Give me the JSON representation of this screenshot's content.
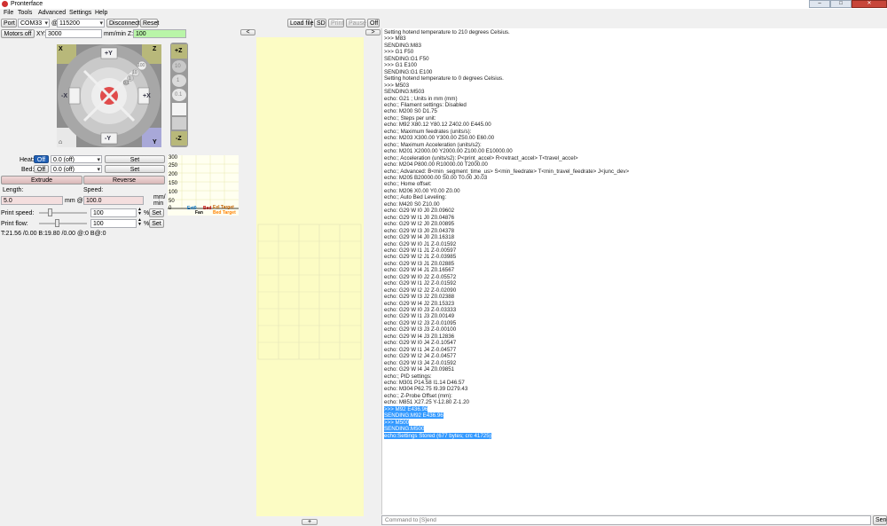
{
  "window": {
    "title": "Pronterface"
  },
  "menu": [
    "File",
    "Tools",
    "Advanced",
    "Settings",
    "Help"
  ],
  "connection": {
    "port_label": "Port",
    "port_value": "COM33",
    "at_label": "@",
    "baud_value": "115200",
    "disconnect_label": "Disconnect",
    "reset_label": "Reset"
  },
  "toolbar": {
    "load_file": "Load file",
    "sd": "SD",
    "print": "Print",
    "pause": "Pause",
    "off": "Off",
    "collapse_left": "<",
    "expand_right": ">",
    "plate_add": "+"
  },
  "motion": {
    "motors_off": "Motors off",
    "xy_label": "XY:",
    "xy_value": "3000",
    "z_label": "mm/min Z:",
    "z_value": "100",
    "jog": {
      "home_x": "X",
      "plus_y": "+Y",
      "z_home": "Z",
      "minus_x": "-X",
      "plus_x": "+X",
      "minus_y": "-Y",
      "home_y": "Y",
      "home_all": "⌂",
      "rings": [
        "100",
        "10",
        "1",
        "0.1"
      ],
      "z_plus": "+Z",
      "z_minus": "-Z",
      "z_steps": [
        "10",
        "1",
        "0.1"
      ]
    }
  },
  "temps": {
    "heat_label": "Heat:",
    "heat_off": "Off",
    "heat_value": "0.0 (off)",
    "bed_label": "Bed:",
    "bed_off": "Off",
    "bed_value": "0.0 (off)",
    "set_label": "Set",
    "extrude": "Extrude",
    "reverse": "Reverse",
    "length_label": "Length:",
    "length_value": "5.0",
    "mm_at": "mm @",
    "speed_label": "Speed:",
    "speed_value": "100.0",
    "speed_unit": "mm/\nmin",
    "print_speed_label": "Print speed:",
    "print_speed_value": "100",
    "print_flow_label": "Print flow:",
    "print_flow_value": "100",
    "percent": "%",
    "status": "T:21.56 /0.00 B:19.80 /0.00 @:0 B@:0"
  },
  "graph": {
    "y_ticks": [
      "300",
      "250",
      "200",
      "150",
      "100",
      "50",
      "0"
    ],
    "legend": [
      {
        "label": "Ext0",
        "color": "#0070c0"
      },
      {
        "label": "Bed",
        "color": "#c00000"
      },
      {
        "label": "Exl Target",
        "color": "#c06000"
      },
      {
        "label": "Fan",
        "color": "#000000"
      },
      {
        "label": "Bed Target",
        "color": "#ff8000"
      }
    ]
  },
  "colors": {
    "accent_blue": "#3399ff",
    "off_button": "#1f5fb5",
    "plate": "#fcfcc4",
    "z_field": "#b9f5a8",
    "jog_olive": "#b8b87a",
    "jog_lavender": "#a8a8d8"
  },
  "console": {
    "lines": [
      {
        "t": "Setting hotend temperature to 210 degrees Celsius."
      },
      {
        "t": ">>> M83"
      },
      {
        "t": "SENDING:M83"
      },
      {
        "t": ">>> G1 F50"
      },
      {
        "t": "SENDING:G1 F50"
      },
      {
        "t": ">>> G1 E100"
      },
      {
        "t": "SENDING:G1 E100"
      },
      {
        "t": "Setting hotend temperature to 0 degrees Celsius."
      },
      {
        "t": ">>> M503"
      },
      {
        "t": "SENDING:M503"
      },
      {
        "t": "echo:  G21    ; Units in mm (mm)"
      },
      {
        "t": "echo:; Filament settings: Disabled"
      },
      {
        "t": "echo:  M200 S0 D1.75"
      },
      {
        "t": "echo:; Steps per unit:"
      },
      {
        "t": "echo: M92 X80.12 Y80.12 Z402.00 E445.00"
      },
      {
        "t": "echo:; Maximum feedrates (units/s):"
      },
      {
        "t": "echo:  M203 X300.00 Y300.00 Z50.00 E60.00"
      },
      {
        "t": "echo:; Maximum Acceleration (units/s2):"
      },
      {
        "t": "echo:  M201 X2000.00 Y2000.00 Z100.00 E10000.00"
      },
      {
        "t": "echo:; Acceleration (units/s2): P<print_accel> R<retract_accel> T<travel_accel>"
      },
      {
        "t": "echo:  M204 P800.00 R10000.00 T2000.00"
      },
      {
        "t": "echo:; Advanced: B<min_segment_time_us> S<min_feedrate> T<min_travel_feedrate> J<junc_dev>"
      },
      {
        "t": "echo:  M205 B20000.00 S0.00 T0.00 J0.03"
      },
      {
        "t": "echo:; Home offset:"
      },
      {
        "t": "echo:  M206 X0.00 Y0.00 Z0.00"
      },
      {
        "t": "echo:; Auto Bed Leveling:"
      },
      {
        "t": "echo:  M420 S0 Z10.00"
      },
      {
        "t": "echo:  G29 W I0 J0 Z0.09602"
      },
      {
        "t": "echo:  G29 W I1 J0 Z0.04876"
      },
      {
        "t": "echo:  G29 W I2 J0 Z0.00895"
      },
      {
        "t": "echo:  G29 W I3 J0 Z0.04378"
      },
      {
        "t": "echo:  G29 W I4 J0 Z0.16318"
      },
      {
        "t": "echo:  G29 W I0 J1 Z-0.01592"
      },
      {
        "t": "echo:  G29 W I1 J1 Z-0.00597"
      },
      {
        "t": "echo:  G29 W I2 J1 Z-0.03985"
      },
      {
        "t": "echo:  G29 W I3 J1 Z0.02885"
      },
      {
        "t": "echo:  G29 W I4 J1 Z0.16567"
      },
      {
        "t": "echo:  G29 W I0 J2 Z-0.05572"
      },
      {
        "t": "echo:  G29 W I1 J2 Z-0.01592"
      },
      {
        "t": "echo:  G29 W I2 J2 Z-0.02090"
      },
      {
        "t": "echo:  G29 W I3 J2 Z0.02388"
      },
      {
        "t": "echo:  G29 W I4 J2 Z0.15323"
      },
      {
        "t": "echo:  G29 W I0 J3 Z-0.03333"
      },
      {
        "t": "echo:  G29 W I1 J3 Z0.00149"
      },
      {
        "t": "echo:  G29 W I2 J3 Z-0.01095"
      },
      {
        "t": "echo:  G29 W I3 J3 Z-0.00100"
      },
      {
        "t": "echo:  G29 W I4 J3 Z0.12836"
      },
      {
        "t": "echo:  G29 W I0 J4 Z-0.10547"
      },
      {
        "t": "echo:  G29 W I1 J4 Z-0.04577"
      },
      {
        "t": "echo:  G29 W I2 J4 Z-0.04577"
      },
      {
        "t": "echo:  G29 W I3 J4 Z-0.01592"
      },
      {
        "t": "echo:  G29 W I4 J4 Z0.09851"
      },
      {
        "t": "echo:; PID settings:"
      },
      {
        "t": "echo:  M301 P14.58 I1.14 D46.57"
      },
      {
        "t": "echo:  M304 P62.75 I9.39 D279.43"
      },
      {
        "t": "echo:; Z-Probe Offset (mm):"
      },
      {
        "t": "echo:  M851 X27.25 Y-12.80 Z-1.20"
      },
      {
        "t": ">>> M92 E436.96",
        "hl": true
      },
      {
        "t": "SENDING:M92 E436.96",
        "hl": true
      },
      {
        "t": ">>> M500",
        "hl": true
      },
      {
        "t": "SENDING:M500",
        "hl": true
      },
      {
        "t": "echo:Settings Stored (677 bytes; crc 41725)",
        "hl": true
      }
    ],
    "command_placeholder": "Command to [S]end",
    "send_label": "Send"
  }
}
